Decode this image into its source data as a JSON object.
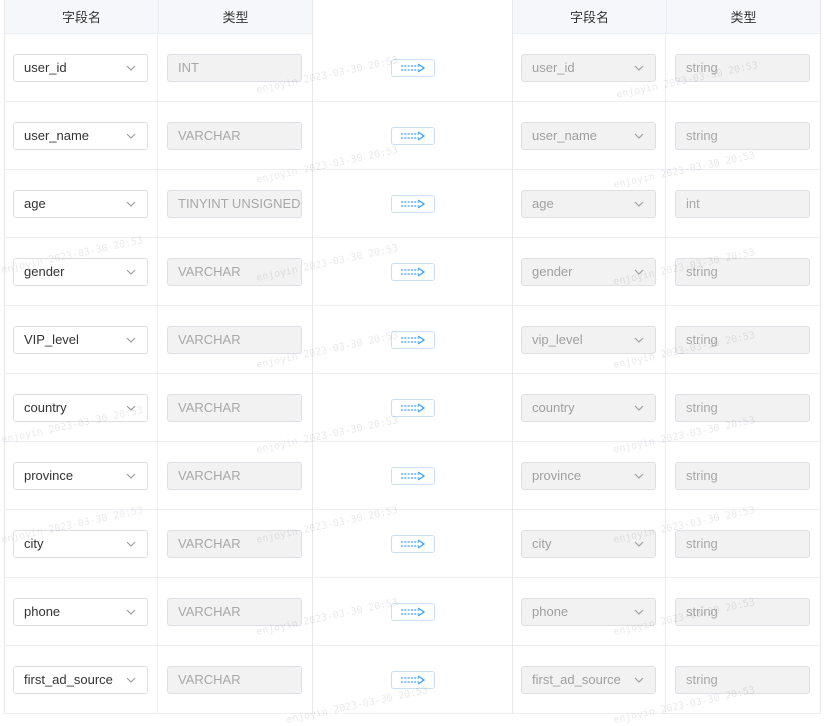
{
  "left": {
    "header": {
      "field_name": "字段名",
      "type": "类型"
    },
    "rows": [
      {
        "field": "user_id",
        "type": "INT"
      },
      {
        "field": "user_name",
        "type": "VARCHAR"
      },
      {
        "field": "age",
        "type": "TINYINT UNSIGNED"
      },
      {
        "field": "gender",
        "type": "VARCHAR"
      },
      {
        "field": "VIP_level",
        "type": "VARCHAR"
      },
      {
        "field": "country",
        "type": "VARCHAR"
      },
      {
        "field": "province",
        "type": "VARCHAR"
      },
      {
        "field": "city",
        "type": "VARCHAR"
      },
      {
        "field": "phone",
        "type": "VARCHAR"
      },
      {
        "field": "first_ad_source",
        "type": "VARCHAR"
      }
    ]
  },
  "right": {
    "header": {
      "field_name": "字段名",
      "type": "类型"
    },
    "rows": [
      {
        "field": "user_id",
        "type": "string"
      },
      {
        "field": "user_name",
        "type": "string"
      },
      {
        "field": "age",
        "type": "int"
      },
      {
        "field": "gender",
        "type": "string"
      },
      {
        "field": "vip_level",
        "type": "string"
      },
      {
        "field": "country",
        "type": "string"
      },
      {
        "field": "province",
        "type": "string"
      },
      {
        "field": "city",
        "type": "string"
      },
      {
        "field": "phone",
        "type": "string"
      },
      {
        "field": "first_ad_source",
        "type": "string"
      }
    ]
  },
  "icons": {
    "chevron": "chevron-down-icon",
    "arrow": "arrow-right-icon"
  },
  "colors": {
    "accent": "#409eff",
    "header_bg": "#f5f7fa",
    "border": "#ebeef5",
    "disabled_bg": "#f2f2f2"
  },
  "watermark": "enjoyin 2023-03-30 20:53"
}
